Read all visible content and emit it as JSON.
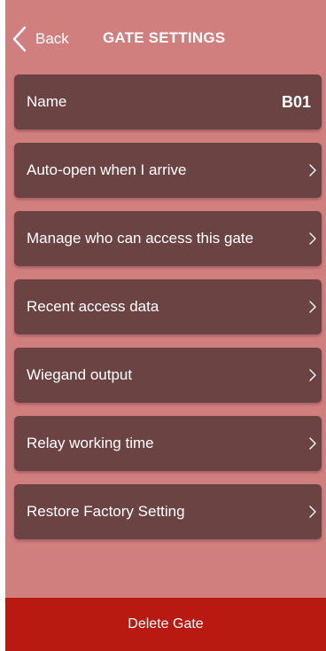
{
  "header": {
    "back_label": "Back",
    "title": "GATE SETTINGS"
  },
  "colors": {
    "screen_background": "#d17e7e",
    "card_background": "#6b4343",
    "delete_background": "#b81a12",
    "text": "#ffffff"
  },
  "icons": {
    "back": "chevron-left-icon",
    "item_arrow": "chevron-right-icon"
  },
  "menu": {
    "name": {
      "label": "Name",
      "value": "B01"
    },
    "items": [
      {
        "label": "Auto-open when I arrive"
      },
      {
        "label": "Manage who can access this gate"
      },
      {
        "label": "Recent access data"
      },
      {
        "label": "Wiegand output"
      },
      {
        "label": "Relay working time"
      },
      {
        "label": "Restore Factory Setting"
      }
    ]
  },
  "footer": {
    "delete_label": "Delete Gate"
  }
}
